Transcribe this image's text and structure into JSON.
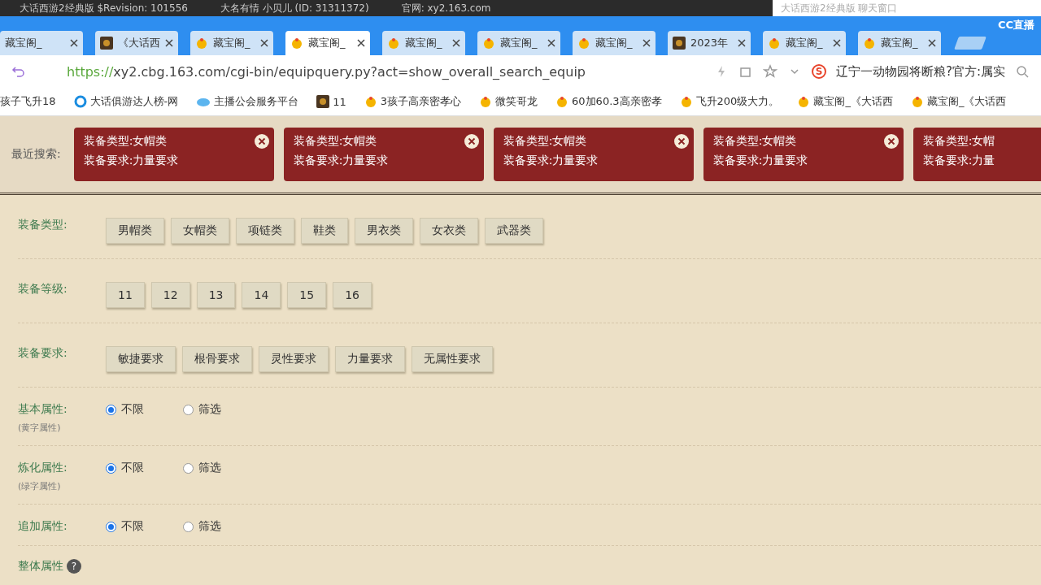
{
  "title_strip": {
    "left": "大话西游2经典版 $Revision: 101556",
    "middle": "大名有情 小贝儿 (ID: 31311372)",
    "site": "官网: xy2.163.com",
    "chat_box": "大话西游2经典版 聊天窗口",
    "logo": "CC直播"
  },
  "tabs": [
    {
      "label": "藏宝阁_",
      "kind": "plain",
      "selected": false
    },
    {
      "label": "《大话西",
      "kind": "game",
      "selected": false
    },
    {
      "label": "藏宝阁_",
      "kind": "chick",
      "selected": false
    },
    {
      "label": "藏宝阁_",
      "kind": "chick",
      "selected": true
    },
    {
      "label": "藏宝阁_",
      "kind": "chick",
      "selected": false
    },
    {
      "label": "藏宝阁_",
      "kind": "chick",
      "selected": false
    },
    {
      "label": "藏宝阁_",
      "kind": "chick",
      "selected": false
    },
    {
      "label": "2023年",
      "kind": "game",
      "selected": false
    },
    {
      "label": "藏宝阁_",
      "kind": "chick",
      "selected": false
    },
    {
      "label": "藏宝阁_",
      "kind": "chick",
      "selected": false
    }
  ],
  "address_bar": {
    "scheme": "https://",
    "url": "xy2.cbg.163.com/cgi-bin/equipquery.py?act=show_overall_search_equip",
    "search_engine": "S",
    "news": "辽宁一动物园将断粮?官方:属实"
  },
  "bookmarks": [
    {
      "label": "孩子飞升18",
      "kind": "plain"
    },
    {
      "label": "大话俱游达人榜-网",
      "kind": "ring"
    },
    {
      "label": "主播公会服务平台",
      "kind": "cloud"
    },
    {
      "label": "11",
      "kind": "game"
    },
    {
      "label": "3孩子高亲密孝心",
      "kind": "chick"
    },
    {
      "label": "微笑哥龙",
      "kind": "chick"
    },
    {
      "label": "60加60.3高亲密孝",
      "kind": "chick"
    },
    {
      "label": "飞升200级大力。",
      "kind": "chick"
    },
    {
      "label": "藏宝阁_《大话西",
      "kind": "chick"
    },
    {
      "label": "藏宝阁_《大话西",
      "kind": "chick"
    }
  ],
  "recent_search": {
    "label": "最近搜索:",
    "cards": [
      {
        "line1": "装备类型:女帽类",
        "line2": "装备要求:力量要求"
      },
      {
        "line1": "装备类型:女帽类",
        "line2": "装备要求:力量要求"
      },
      {
        "line1": "装备类型:女帽类",
        "line2": "装备要求:力量要求"
      },
      {
        "line1": "装备类型:女帽类",
        "line2": "装备要求:力量要求"
      },
      {
        "line1": "装备类型:女帽",
        "line2": "装备要求:力量"
      }
    ]
  },
  "filters": [
    {
      "kind": "buttons",
      "label": "装备类型:",
      "options": [
        "男帽类",
        "女帽类",
        "项链类",
        "鞋类",
        "男衣类",
        "女衣类",
        "武器类"
      ]
    },
    {
      "kind": "buttons",
      "label": "装备等级:",
      "options": [
        "11",
        "12",
        "13",
        "14",
        "15",
        "16"
      ]
    },
    {
      "kind": "buttons",
      "label": "装备要求:",
      "options": [
        "敏捷要求",
        "根骨要求",
        "灵性要求",
        "力量要求",
        "无属性要求"
      ]
    },
    {
      "kind": "radio",
      "label": "基本属性:",
      "note": "(黄字属性)",
      "options": [
        {
          "label": "不限",
          "selected": true
        },
        {
          "label": "筛选",
          "selected": false
        }
      ]
    },
    {
      "kind": "radio",
      "label": "炼化属性:",
      "note": "(绿字属性)",
      "options": [
        {
          "label": "不限",
          "selected": true
        },
        {
          "label": "筛选",
          "selected": false
        }
      ]
    },
    {
      "kind": "radio",
      "label": "追加属性:",
      "options": [
        {
          "label": "不限",
          "selected": true
        },
        {
          "label": "筛选",
          "selected": false
        }
      ]
    },
    {
      "kind": "heading",
      "label": "整体属性",
      "help": "?"
    }
  ]
}
